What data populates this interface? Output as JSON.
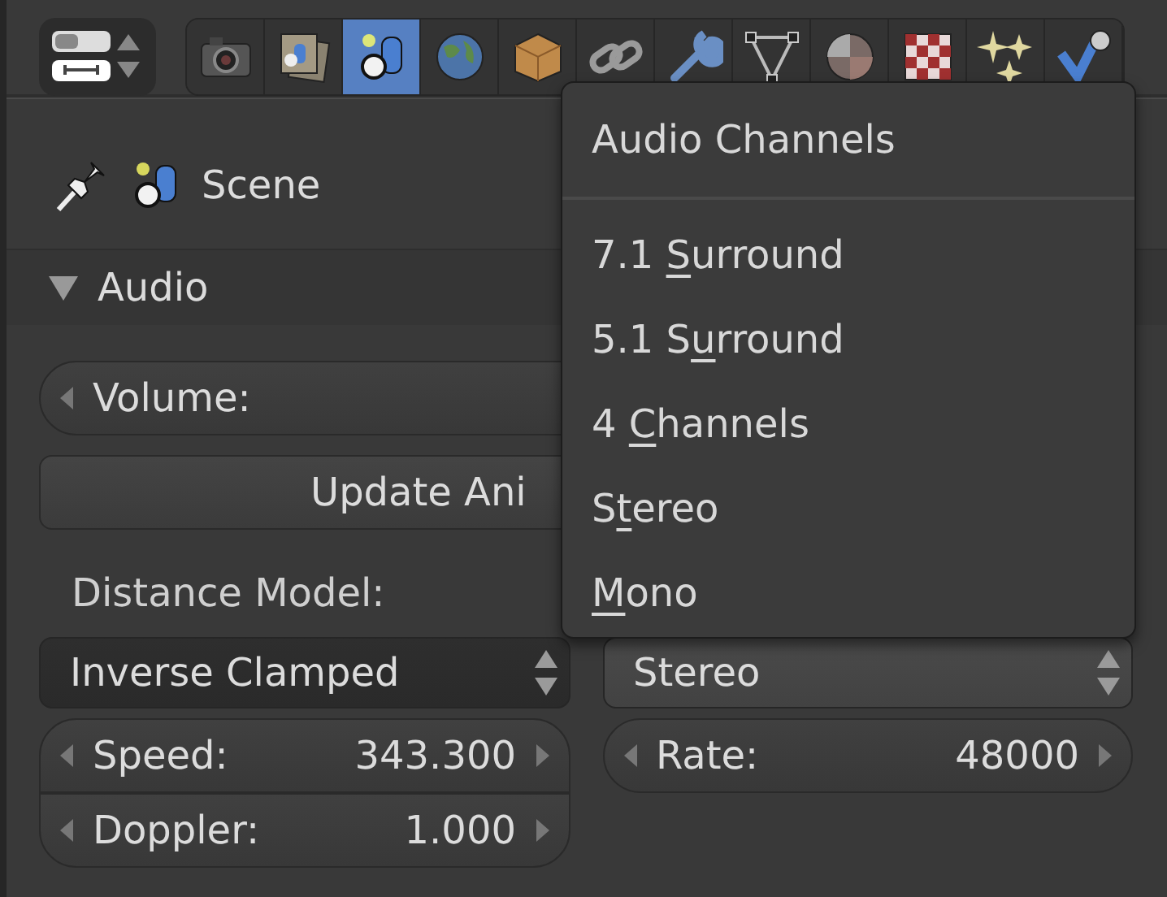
{
  "properties_tabs": [
    {
      "selected": false
    },
    {
      "selected": false
    },
    {
      "selected": true
    },
    {
      "selected": false
    },
    {
      "selected": false
    },
    {
      "selected": false
    },
    {
      "selected": false
    },
    {
      "selected": false
    },
    {
      "selected": false
    },
    {
      "selected": false
    },
    {
      "selected": false
    },
    {
      "selected": false
    }
  ],
  "context": {
    "label": "Scene"
  },
  "panel": {
    "title": "Audio",
    "expanded": true,
    "volume": {
      "label": "Volume:"
    },
    "update_button": {
      "label": "Update Ani"
    },
    "distance_model": {
      "label": "Distance Model:",
      "value": "Inverse Clamped",
      "open": false
    },
    "channels": {
      "value": "Stereo",
      "open": true
    },
    "speed": {
      "label": "Speed:",
      "value": "343.300"
    },
    "doppler": {
      "label": "Doppler:",
      "value": "1.000"
    },
    "rate": {
      "label": "Rate:",
      "value": "48000"
    }
  },
  "menu": {
    "title": "Audio Channels",
    "items": [
      {
        "before": "7.1 ",
        "key": "S",
        "after": "urround"
      },
      {
        "before": "5.1 S",
        "key": "u",
        "after": "rround"
      },
      {
        "before": "4 ",
        "key": "C",
        "after": "hannels"
      },
      {
        "before": "S",
        "key": "t",
        "after": "ereo"
      },
      {
        "key": "M",
        "after": "ono"
      }
    ]
  }
}
